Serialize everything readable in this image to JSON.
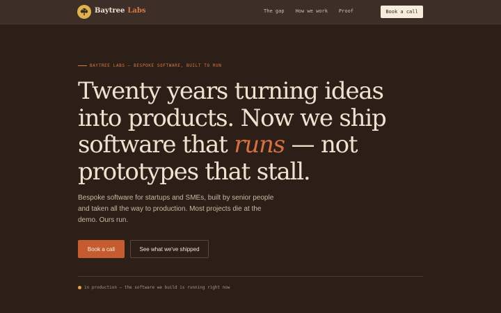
{
  "nav": {
    "brand_primary": "Baytree",
    "brand_secondary": "Labs",
    "links": [
      "The gap",
      "How we work",
      "Proof"
    ],
    "cta_label": "Book a call"
  },
  "hero": {
    "eyebrow": "BAYTREE LABS — BESPOKE SOFTWARE, BUILT TO RUN",
    "headline": {
      "line1": "Twenty years turning ideas",
      "line2": "into products. Now we ship",
      "line3_before": "software that ",
      "line3_accent": "runs",
      "line3_after": " — not",
      "line4": "prototypes that stall."
    },
    "subheading": "Bespoke software for startups and SMEs, built by senior people and taken all the way to production. Most projects die at the demo. Ours run.",
    "primary_cta": "Book a call",
    "secondary_cta": "See what we've shipped"
  },
  "status": {
    "text": "in production — the software we build is running right now"
  },
  "colors": {
    "background": "#2c1f18",
    "nav_background": "#3d2f28",
    "accent": "#d8703f",
    "primary_button": "#c45c2f",
    "cream": "#efe3cf",
    "logo": "#e0b24e"
  },
  "icons": {
    "logo": "tree-icon",
    "status": "status-dot-icon"
  }
}
